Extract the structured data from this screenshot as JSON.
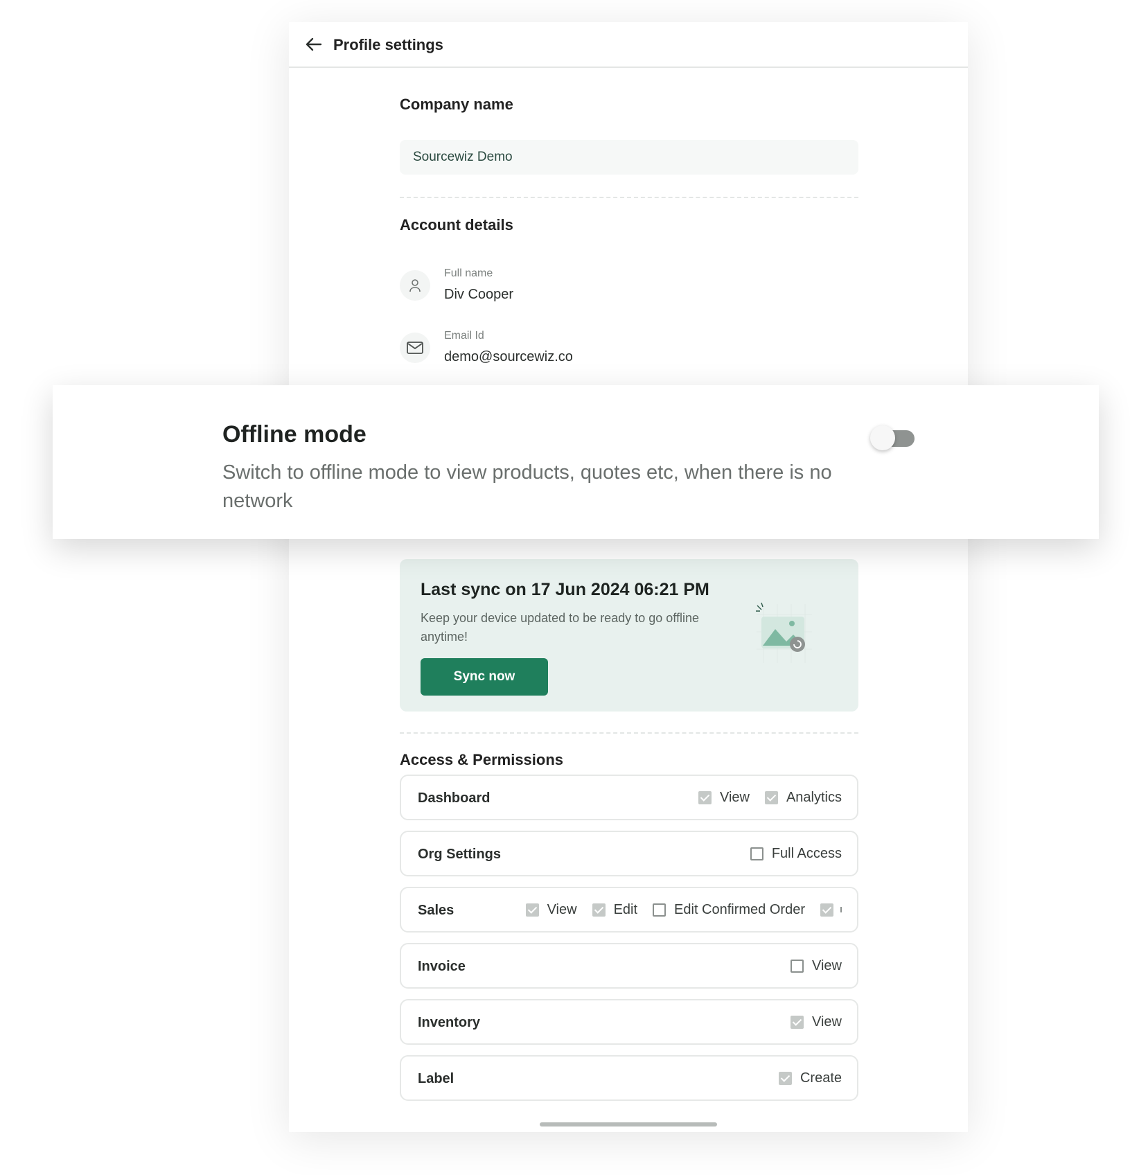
{
  "header": {
    "title": "Profile settings",
    "back_icon": "arrow-left-icon"
  },
  "company": {
    "section_title": "Company name",
    "value": "Sourcewiz Demo"
  },
  "account": {
    "section_title": "Account details",
    "full_name_label": "Full name",
    "full_name_value": "Div Cooper",
    "email_label": "Email Id",
    "email_value": "demo@sourcewiz.co"
  },
  "offline": {
    "title": "Offline mode",
    "description": "Switch to offline mode to view products, quotes etc, when there is no network",
    "enabled": false
  },
  "sync": {
    "title": "Last sync on 17 Jun 2024 06:21 PM",
    "subtitle": "Keep your device updated to be ready to go offline anytime!",
    "button_label": "Sync now",
    "accent": "#1f7f5c"
  },
  "permissions": {
    "section_title": "Access & Permissions",
    "rows": [
      {
        "name": "Dashboard",
        "options": [
          {
            "label": "View",
            "checked": true
          },
          {
            "label": "Analytics",
            "checked": true
          }
        ]
      },
      {
        "name": "Org Settings",
        "options": [
          {
            "label": "Full Access",
            "checked": false
          }
        ]
      },
      {
        "name": "Sales",
        "options": [
          {
            "label": "View",
            "checked": true
          },
          {
            "label": "Edit",
            "checked": true
          },
          {
            "label": "Edit Confirmed Order",
            "checked": false
          }
        ]
      },
      {
        "name": "Invoice",
        "options": [
          {
            "label": "View",
            "checked": false
          }
        ]
      },
      {
        "name": "Inventory",
        "options": [
          {
            "label": "View",
            "checked": true
          }
        ]
      },
      {
        "name": "Label",
        "options": [
          {
            "label": "Create",
            "checked": true
          }
        ]
      }
    ]
  }
}
